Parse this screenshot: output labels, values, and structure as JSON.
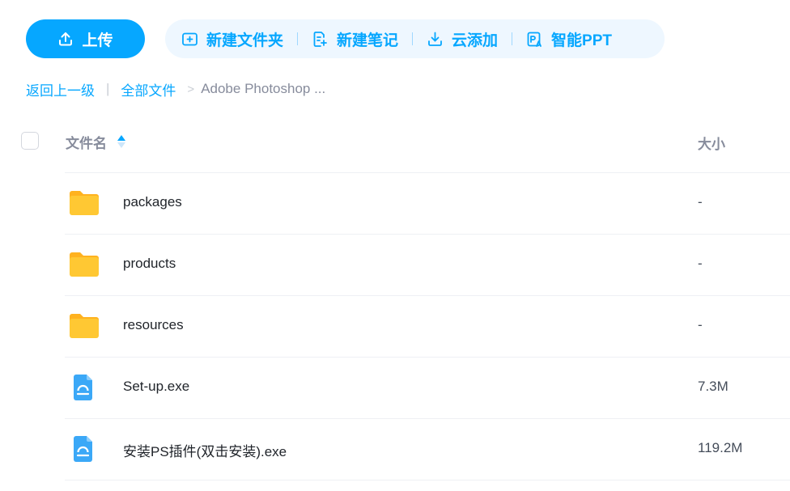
{
  "toolbar": {
    "upload_label": "上传",
    "actions": [
      {
        "label": "新建文件夹",
        "icon": "new-folder-icon"
      },
      {
        "label": "新建笔记",
        "icon": "new-note-icon"
      },
      {
        "label": "云添加",
        "icon": "cloud-add-icon"
      },
      {
        "label": "智能PPT",
        "icon": "smart-ppt-icon"
      }
    ]
  },
  "breadcrumb": {
    "back": "返回上一级",
    "separator": "|",
    "root": "全部文件",
    "arrow": ">",
    "current": "Adobe Photoshop ..."
  },
  "table": {
    "columns": {
      "name": "文件名",
      "size": "大小"
    },
    "rows": [
      {
        "name": "packages",
        "size": "-",
        "type": "folder"
      },
      {
        "name": "products",
        "size": "-",
        "type": "folder"
      },
      {
        "name": "resources",
        "size": "-",
        "type": "folder"
      },
      {
        "name": "Set-up.exe",
        "size": "7.3M",
        "type": "exe"
      },
      {
        "name": "安装PS插件(双击安装).exe",
        "size": "119.2M",
        "type": "exe"
      }
    ]
  },
  "colors": {
    "accent": "#06a7ff",
    "toolbar_bg": "#eef7ff",
    "folder": "#ffc833",
    "exe_icon": "#3ba8f7",
    "header_text": "#878c9c"
  }
}
